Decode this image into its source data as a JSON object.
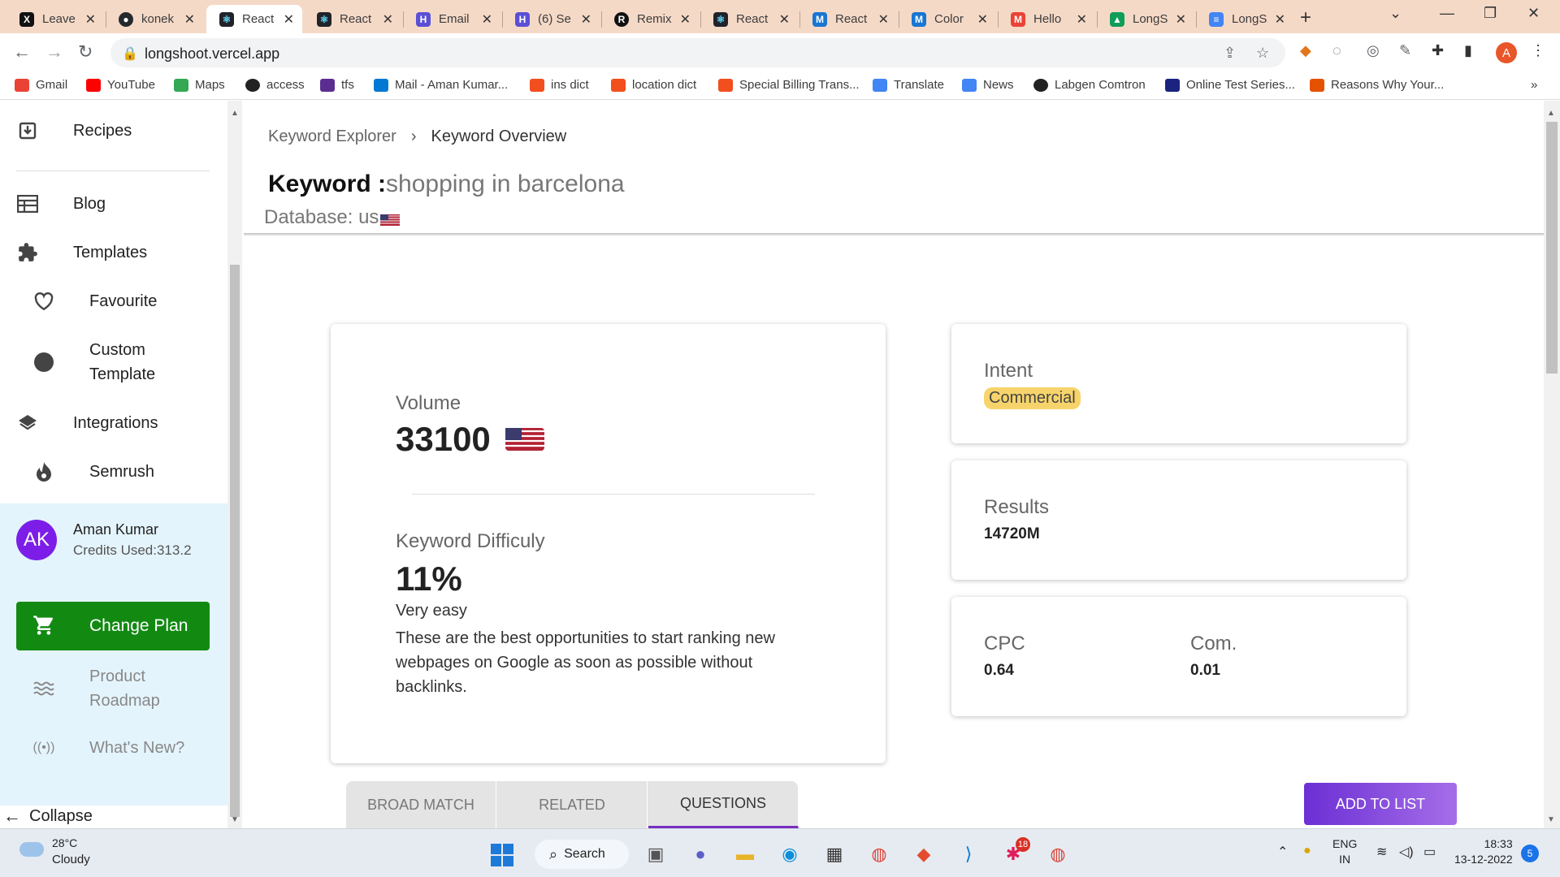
{
  "browser": {
    "tabs": [
      {
        "label": "Leave",
        "icon": "x-icon",
        "color": "#111111"
      },
      {
        "label": "konek",
        "icon": "github-icon",
        "color": "#24292e"
      },
      {
        "label": "React",
        "icon": "react-icon",
        "color": "#20232a"
      },
      {
        "label": "React",
        "icon": "react-icon",
        "color": "#20232a"
      },
      {
        "label": "Email",
        "icon": "h-icon",
        "color": "#5b4fd6"
      },
      {
        "label": "(6) Se",
        "icon": "h-icon",
        "color": "#5b4fd6"
      },
      {
        "label": "Remix",
        "icon": "remix-icon",
        "color": "#111111"
      },
      {
        "label": "React",
        "icon": "react-icon",
        "color": "#20232a"
      },
      {
        "label": "React",
        "icon": "mui-icon",
        "color": "#1976d2"
      },
      {
        "label": "Color",
        "icon": "mui-icon",
        "color": "#1976d2"
      },
      {
        "label": "Hello",
        "icon": "gmail-icon",
        "color": "#ea4335"
      },
      {
        "label": "LongS",
        "icon": "drive-icon",
        "color": "#0f9d58"
      },
      {
        "label": "LongS",
        "icon": "docs-icon",
        "color": "#4285f4"
      }
    ],
    "url": "longshoot.vercel.app",
    "profile_initial": "A",
    "bookmarks": [
      {
        "label": "Gmail",
        "color": "#ea4335"
      },
      {
        "label": "YouTube",
        "color": "#ff0000"
      },
      {
        "label": "Maps",
        "color": "#34a853"
      },
      {
        "label": "access",
        "color": "#222222"
      },
      {
        "label": "tfs",
        "color": "#5c2d91"
      },
      {
        "label": "Mail - Aman Kumar...",
        "color": "#0078d4"
      },
      {
        "label": "ins dict",
        "color": "#f24e1e"
      },
      {
        "label": "location dict",
        "color": "#f24e1e"
      },
      {
        "label": "Special Billing Trans...",
        "color": "#f24e1e"
      },
      {
        "label": "Translate",
        "color": "#4285f4"
      },
      {
        "label": "News",
        "color": "#4285f4"
      },
      {
        "label": "Labgen Comtron",
        "color": "#222222"
      },
      {
        "label": "Online Test Series...",
        "color": "#1a237e"
      },
      {
        "label": "Reasons Why Your...",
        "color": "#e65100"
      }
    ],
    "overflow": "»"
  },
  "sidebar": {
    "items": [
      {
        "label": "Recipes",
        "icon": "download-box-icon"
      },
      {
        "label": "Blog",
        "icon": "calendar-view-icon"
      },
      {
        "label": "Templates",
        "icon": "puzzle-icon"
      },
      {
        "label": "Favourite",
        "icon": "heart-icon"
      },
      {
        "label": "Custom Template",
        "icon": "circle-icon"
      },
      {
        "label": "Integrations",
        "icon": "layers-icon"
      },
      {
        "label": "Semrush",
        "icon": "flame-icon"
      }
    ],
    "user": {
      "initials": "AK",
      "name": "Aman Kumar",
      "credits": "Credits Used:313.2"
    },
    "change_plan": "Change Plan",
    "lower_items": [
      {
        "label": "Product Roadmap",
        "icon": "roadmap-icon"
      },
      {
        "label": "What's New?",
        "icon": "broadcast-icon"
      }
    ],
    "collapse": "Collapse"
  },
  "main": {
    "breadcrumb": {
      "root": "Keyword Explorer",
      "current": "Keyword Overview"
    },
    "keyword_label": "Keyword :",
    "keyword_value": "shopping in barcelona",
    "database_label": "Database: us",
    "volume": {
      "label": "Volume",
      "value": "33100"
    },
    "difficulty": {
      "label": "Keyword Difficuly",
      "value": "11%",
      "level": "Very easy",
      "description": "These are the best opportunities to start ranking new webpages on Google as soon as possible without backlinks."
    },
    "intent": {
      "label": "Intent",
      "value": "Commercial"
    },
    "results": {
      "label": "Results",
      "value": "14720M"
    },
    "cpc": {
      "label": "CPC",
      "value": "0.64"
    },
    "com": {
      "label": "Com.",
      "value": "0.01"
    },
    "tabs": [
      "BROAD MATCH",
      "RELATED",
      "QUESTIONS"
    ],
    "active_tab": "QUESTIONS",
    "add_to_list": "ADD TO LIST"
  },
  "taskbar": {
    "temperature": "28°C",
    "condition": "Cloudy",
    "search": "Search",
    "lang_top": "ENG",
    "lang_bottom": "IN",
    "time": "18:33",
    "date": "13-12-2022",
    "notifications": "5",
    "slack_badge": "18"
  },
  "colors": {
    "accent_green": "#128a12",
    "accent_purple": "#7a2fc2",
    "intent_badge": "#f7d46b",
    "sidebar_lower_bg": "#e4f4fc"
  }
}
